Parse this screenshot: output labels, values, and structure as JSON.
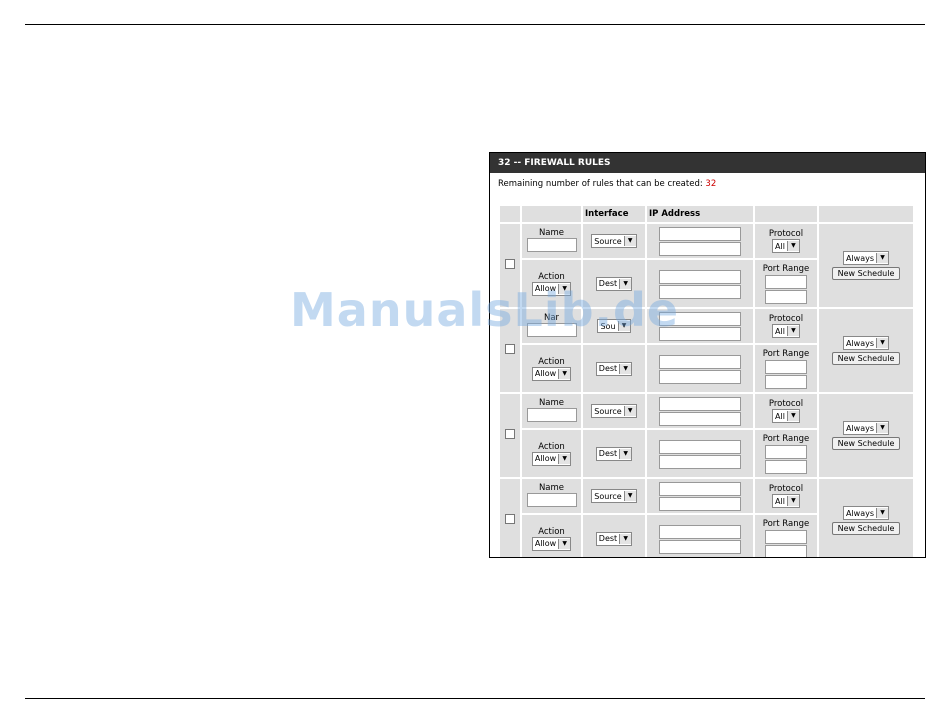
{
  "panel": {
    "title": "32 -- FIREWALL RULES",
    "remaining_label": "Remaining number of rules that can be created:",
    "remaining_count": "32"
  },
  "table": {
    "headers": {
      "interface": "Interface",
      "ip_address": "IP Address"
    }
  },
  "labels": {
    "name": "Name",
    "action": "Action",
    "protocol": "Protocol",
    "port_range": "Port Range"
  },
  "rows": [
    {
      "name_label": "Name",
      "action_value": "Allow",
      "source_value": "Source",
      "dest_value": "Dest",
      "protocol_value": "All",
      "schedule_value": "Always",
      "new_schedule": "New Schedule"
    },
    {
      "name_label": "Nar",
      "action_value": "Allow",
      "source_value": "Sou",
      "dest_value": "Dest",
      "protocol_value": "All",
      "schedule_value": "Always",
      "new_schedule": "New Schedule"
    },
    {
      "name_label": "Name",
      "action_value": "Allow",
      "source_value": "Source",
      "dest_value": "Dest",
      "protocol_value": "All",
      "schedule_value": "Always",
      "new_schedule": "New Schedule"
    },
    {
      "name_label": "Name",
      "action_value": "Allow",
      "source_value": "Source",
      "dest_value": "Dest",
      "protocol_value": "All",
      "schedule_value": "Always",
      "new_schedule": "New Schedule"
    }
  ],
  "watermark": "ManualsLib.de",
  "colors": {
    "header_bg": "#333333",
    "cell_bg": "#dfdfdf",
    "count": "#cc0000",
    "watermark": "#78aae1"
  }
}
